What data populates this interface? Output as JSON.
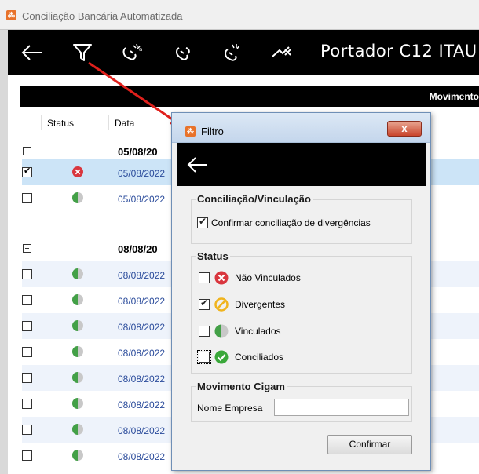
{
  "window": {
    "title": "Conciliação Bancária Automatizada"
  },
  "toolbar": {
    "title": "Portador C12  ITAU -"
  },
  "section": {
    "title": "Movimento"
  },
  "columns": {
    "status": "Status",
    "date": "Data"
  },
  "groups": [
    {
      "date": "05/08/20",
      "rows": [
        {
          "checked": true,
          "status": "nao-vinculado",
          "date": "05/08/2022",
          "selected": true
        },
        {
          "checked": false,
          "status": "vinculado",
          "date": "05/08/2022",
          "selected": false
        }
      ]
    },
    {
      "date": "08/08/20",
      "rows": [
        {
          "checked": false,
          "status": "vinculado",
          "date": "08/08/2022"
        },
        {
          "checked": false,
          "status": "vinculado",
          "date": "08/08/2022"
        },
        {
          "checked": false,
          "status": "vinculado",
          "date": "08/08/2022"
        },
        {
          "checked": false,
          "status": "vinculado",
          "date": "08/08/2022"
        },
        {
          "checked": false,
          "status": "vinculado",
          "date": "08/08/2022"
        },
        {
          "checked": false,
          "status": "vinculado",
          "date": "08/08/2022"
        },
        {
          "checked": false,
          "status": "vinculado",
          "date": "08/08/2022"
        },
        {
          "checked": false,
          "status": "vinculado",
          "date": "08/08/2022"
        }
      ]
    }
  ],
  "dialog": {
    "title": "Filtro",
    "close_label": "x",
    "group_conciliacao": {
      "label": "Conciliação/Vinculação",
      "option": {
        "label": "Confirmar conciliação de divergências",
        "checked": true
      }
    },
    "group_status": {
      "label": "Status",
      "options": [
        {
          "label": "Não Vinculados",
          "checked": false,
          "icon": "error-icon"
        },
        {
          "label": "Divergentes",
          "checked": true,
          "icon": "divergent-icon"
        },
        {
          "label": "Vinculados",
          "checked": false,
          "icon": "half-circle-icon"
        },
        {
          "label": "Conciliados",
          "checked": false,
          "icon": "check-circle-icon"
        }
      ]
    },
    "group_movimento": {
      "label": "Movimento Cigam",
      "field_label": "Nome Empresa",
      "field_value": ""
    },
    "confirm_label": "Confirmar"
  },
  "colors": {
    "error": "#d9363e",
    "divergent": "#f0b41e",
    "linked_green": "#43a047",
    "linked_gray": "#c8c8c8",
    "conciliado": "#3aa83a",
    "annotation_arrow": "#e0201c"
  }
}
